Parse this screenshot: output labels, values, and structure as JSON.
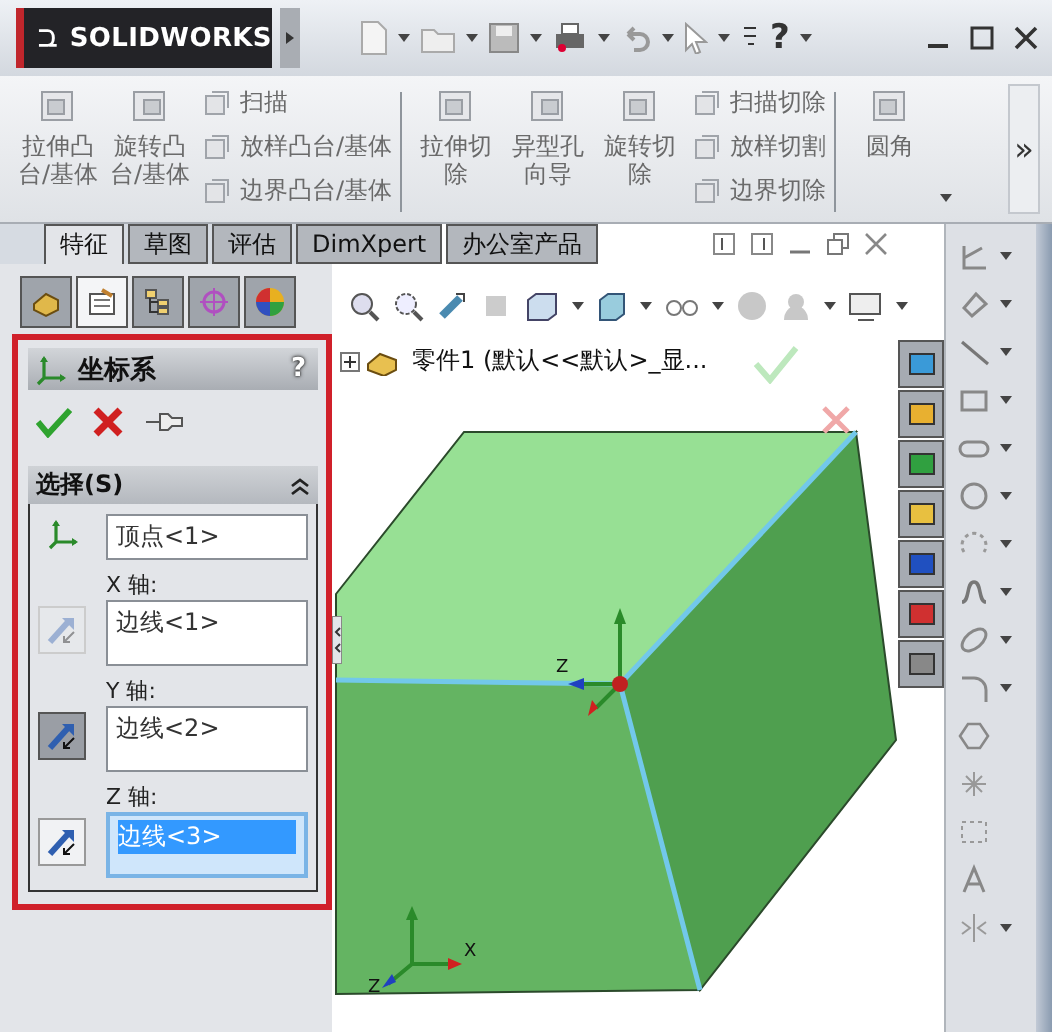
{
  "app": {
    "logo": "SOLIDWORKS",
    "help": "?"
  },
  "ribbon": {
    "sections": [
      {
        "items": [
          {
            "kind": "large",
            "label": "拉伸凸台/基体",
            "disabled": true
          },
          {
            "kind": "large",
            "label": "旋转凸台/基体",
            "disabled": true
          },
          {
            "kind": "small",
            "label": "扫描",
            "disabled": true
          },
          {
            "kind": "small",
            "label": "放样凸台/基体",
            "disabled": true
          },
          {
            "kind": "small",
            "label": "边界凸台/基体",
            "disabled": true
          }
        ]
      },
      {
        "items": [
          {
            "kind": "large",
            "label": "拉伸切除",
            "disabled": true
          },
          {
            "kind": "large",
            "label": "异型孔向导",
            "disabled": true
          },
          {
            "kind": "large",
            "label": "旋转切除",
            "disabled": true
          },
          {
            "kind": "small",
            "label": "扫描切除",
            "disabled": true
          },
          {
            "kind": "small",
            "label": "放样切割",
            "disabled": true
          },
          {
            "kind": "small",
            "label": "边界切除",
            "disabled": true
          }
        ]
      },
      {
        "items": [
          {
            "kind": "large",
            "label": "圆角",
            "disabled": true
          }
        ]
      }
    ],
    "more": "»"
  },
  "feature_tabs": [
    {
      "label": "特征",
      "selected": true
    },
    {
      "label": "草图",
      "selected": false
    },
    {
      "label": "评估",
      "selected": false
    },
    {
      "label": "DimXpert",
      "selected": false
    },
    {
      "label": "办公室产品",
      "selected": false
    }
  ],
  "panel_tabs": [
    {
      "kind": "tree",
      "selected": false
    },
    {
      "kind": "properties",
      "selected": true
    },
    {
      "kind": "configuration",
      "selected": false
    },
    {
      "kind": "dimxpert",
      "selected": false
    },
    {
      "kind": "appearance",
      "selected": false
    }
  ],
  "property_manager": {
    "title": "坐标系",
    "help": "?",
    "section": {
      "title": "选择(S)",
      "fields": [
        {
          "kind": "origin",
          "value": "顶点<1>",
          "selected": false
        },
        {
          "kind": "axis",
          "label": "X 轴:",
          "value": "边线<1>",
          "selected": false,
          "pressed": false,
          "dimmed": true
        },
        {
          "kind": "axis",
          "label": "Y 轴:",
          "value": "边线<2>",
          "selected": false,
          "pressed": true,
          "dimmed": false
        },
        {
          "kind": "axis",
          "label": "Z 轴:",
          "value": "边线<3>",
          "selected": true,
          "pressed": false,
          "dimmed": false
        }
      ]
    }
  },
  "graphics": {
    "tree_label": "零件1 (默认<<默认>_显...",
    "triads": [
      {
        "labels": [
          "Z"
        ]
      },
      {
        "labels": [
          "X",
          "Z"
        ]
      }
    ]
  }
}
